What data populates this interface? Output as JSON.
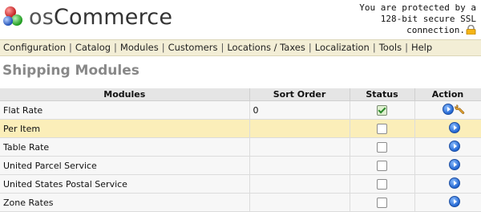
{
  "header": {
    "logo": {
      "prefix": "os",
      "name": "Commerce"
    },
    "ssl": {
      "line1": "You are protected by a",
      "line2": "128-bit secure SSL",
      "line3": "connection."
    }
  },
  "nav": {
    "items": [
      "Configuration",
      "Catalog",
      "Modules",
      "Customers",
      "Locations / Taxes",
      "Localization",
      "Tools",
      "Help"
    ],
    "separator": "|"
  },
  "page": {
    "title": "Shipping Modules"
  },
  "table": {
    "headers": {
      "modules": "Modules",
      "sort_order": "Sort Order",
      "status": "Status",
      "action": "Action"
    },
    "rows": [
      {
        "module": "Flat Rate",
        "sort_order": "0",
        "enabled": true,
        "selected": false
      },
      {
        "module": "Per Item",
        "sort_order": "",
        "enabled": false,
        "selected": true
      },
      {
        "module": "Table Rate",
        "sort_order": "",
        "enabled": false,
        "selected": false
      },
      {
        "module": "United Parcel Service",
        "sort_order": "",
        "enabled": false,
        "selected": false
      },
      {
        "module": "United States Postal Service",
        "sort_order": "",
        "enabled": false,
        "selected": false
      },
      {
        "module": "Zone Rates",
        "sort_order": "",
        "enabled": false,
        "selected": false
      }
    ]
  },
  "colors": {
    "nav_bg": "#f3eed6",
    "selected_row": "#fbeeb9",
    "header_bg": "#e5e5e5",
    "title": "#888888"
  }
}
